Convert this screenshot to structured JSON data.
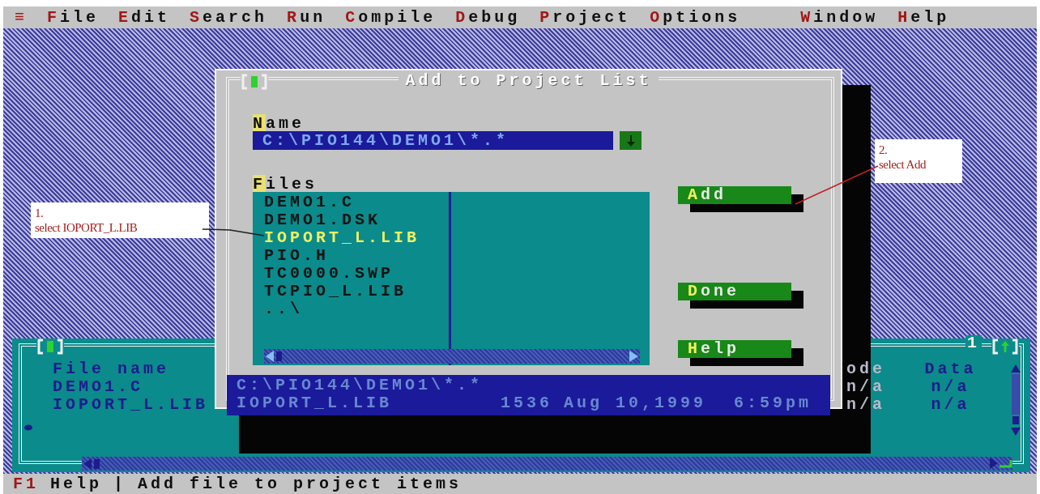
{
  "menu_bar": [
    "≡",
    "File",
    "Edit",
    "Search",
    "Run",
    "Compile",
    "Debug",
    "Project",
    "Options",
    "Window",
    "Help"
  ],
  "project_window": {
    "number": "1",
    "columns": [
      "File name",
      "ode",
      "Data"
    ],
    "rows": [
      [
        "DEMO1.C",
        "n/a",
        "n/a"
      ],
      [
        "IOPORT_L.LIB",
        "n/a",
        "n/a"
      ]
    ]
  },
  "dialog": {
    "title": "Add to Project List",
    "name_label": "Name",
    "name_value": "C:\\PIO144\\DEMO1\\*.*",
    "files_label": "Files",
    "files": [
      {
        "name": "DEMO1.C",
        "selected": false
      },
      {
        "name": "DEMO1.DSK",
        "selected": false
      },
      {
        "name": "IOPORT_L.LIB",
        "selected": true
      },
      {
        "name": "PIO.H",
        "selected": false
      },
      {
        "name": "TC0000.SWP",
        "selected": false
      },
      {
        "name": "TCPIO_L.LIB",
        "selected": false
      },
      {
        "name": "..\\",
        "selected": false
      }
    ],
    "buttons": [
      "Add",
      "Done",
      "Help"
    ],
    "info": {
      "path": "C:\\PIO144\\DEMO1\\*.*",
      "file": "IOPORT_L.LIB",
      "size": "1536",
      "date": "Aug 10,1999",
      "time": "6:59pm"
    }
  },
  "annotations": [
    {
      "number": "1.",
      "text": "select IOPORT_L.LIB"
    },
    {
      "number": "2.",
      "text": "select Add"
    }
  ],
  "status_bar": {
    "key": "F1",
    "key_label": "Help",
    "separator": "|",
    "message": "Add file to project items"
  }
}
